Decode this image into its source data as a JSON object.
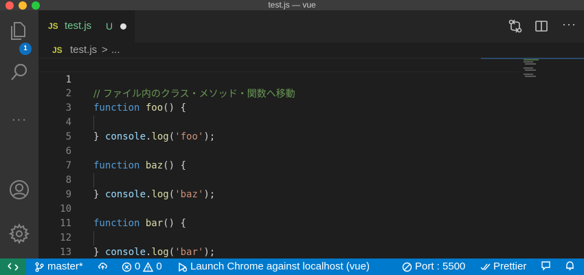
{
  "window": {
    "title": "test.js — vue"
  },
  "activity_bar": {
    "explorer_badge": "1"
  },
  "tab": {
    "lang_badge": "JS",
    "filename": "test.js",
    "status": "U"
  },
  "breadcrumb": {
    "lang_badge": "JS",
    "file": "test.js",
    "separator": ">",
    "more": "..."
  },
  "editor": {
    "line_numbers": [
      "1",
      "2",
      "3",
      "4",
      "5",
      "6",
      "7",
      "8",
      "9",
      "10",
      "11",
      "12",
      "13"
    ],
    "comment": "// ファイル内のクラス・メソッド・関数へ移動",
    "functions": [
      {
        "keyword": "function",
        "name": "foo",
        "open": "() {",
        "obj": "console",
        "dot": ".",
        "method": "log",
        "arg_open": "(",
        "arg": "'foo'",
        "arg_close": ");",
        "close": "}"
      },
      {
        "keyword": "function",
        "name": "baz",
        "open": "() {",
        "obj": "console",
        "dot": ".",
        "method": "log",
        "arg_open": "(",
        "arg": "'baz'",
        "arg_close": ");",
        "close": "}"
      },
      {
        "keyword": "function",
        "name": "bar",
        "open": "() {",
        "obj": "console",
        "dot": ".",
        "method": "log",
        "arg_open": "(",
        "arg": "'bar'",
        "arg_close": ");",
        "close": "}"
      }
    ]
  },
  "status_bar": {
    "branch": "master*",
    "errors": "0",
    "warnings": "0",
    "launch": "Launch Chrome against localhost (vue)",
    "port": "Port : 5500",
    "prettier": "Prettier"
  },
  "colors": {
    "statusbar": "#007acc",
    "remote": "#16825d",
    "badge": "#0e70c0",
    "untracked": "#73c991"
  }
}
